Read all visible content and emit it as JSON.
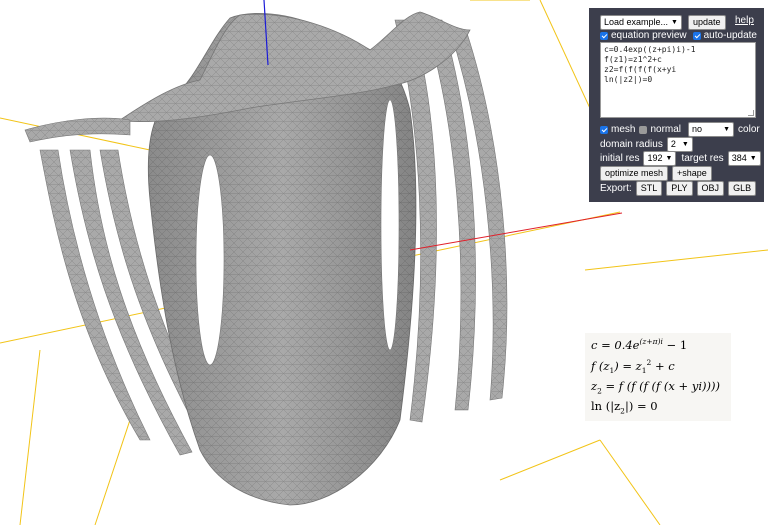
{
  "panel": {
    "load_example": "Load example...",
    "update": "update",
    "help": "help",
    "equation_preview": "equation preview",
    "auto_update": "auto-update",
    "code_lines": [
      "c=0.4exp((z+pi)i)-1",
      "f(z1)=z1^2+c",
      "z2=f(f(f(f(x+yi",
      "ln(|z2|)=0"
    ],
    "mesh": "mesh",
    "normal": "normal",
    "color_select": "no",
    "color": "color",
    "domain_radius_label": "domain radius",
    "domain_radius_value": "2",
    "initial_res_label": "initial res",
    "initial_res_value": "192",
    "target_res_label": "target res",
    "target_res_value": "384",
    "optimize_mesh": "optimize mesh",
    "add_shape": "+shape",
    "export_label": "Export:",
    "export_formats": [
      "STL",
      "PLY",
      "OBJ",
      "GLB"
    ]
  },
  "preview": {
    "eq1_lhs": "c = 0.4e",
    "eq1_exp": "(z+π)i",
    "eq1_tail": " − 1",
    "eq2_lhs": "f (z",
    "eq2_sub": "1",
    "eq2_mid": ") = z",
    "eq2_sub2": "1",
    "eq2_sup": "2",
    "eq2_tail": " + c",
    "eq3_lhs": "z",
    "eq3_sub": "2",
    "eq3_tail": " = f (f (f (f (x + yi))))",
    "eq4_lhs": "ln (|z",
    "eq4_sub": "2",
    "eq4_tail": "|) = 0"
  },
  "colors": {
    "panel_bg": "#3c3e4c",
    "surface": "#a9a9a9",
    "axis_x": "#e0202a",
    "axis_y": "#1a1ad8",
    "grid": "#f2c418",
    "checkbox": "#1a73e8"
  }
}
